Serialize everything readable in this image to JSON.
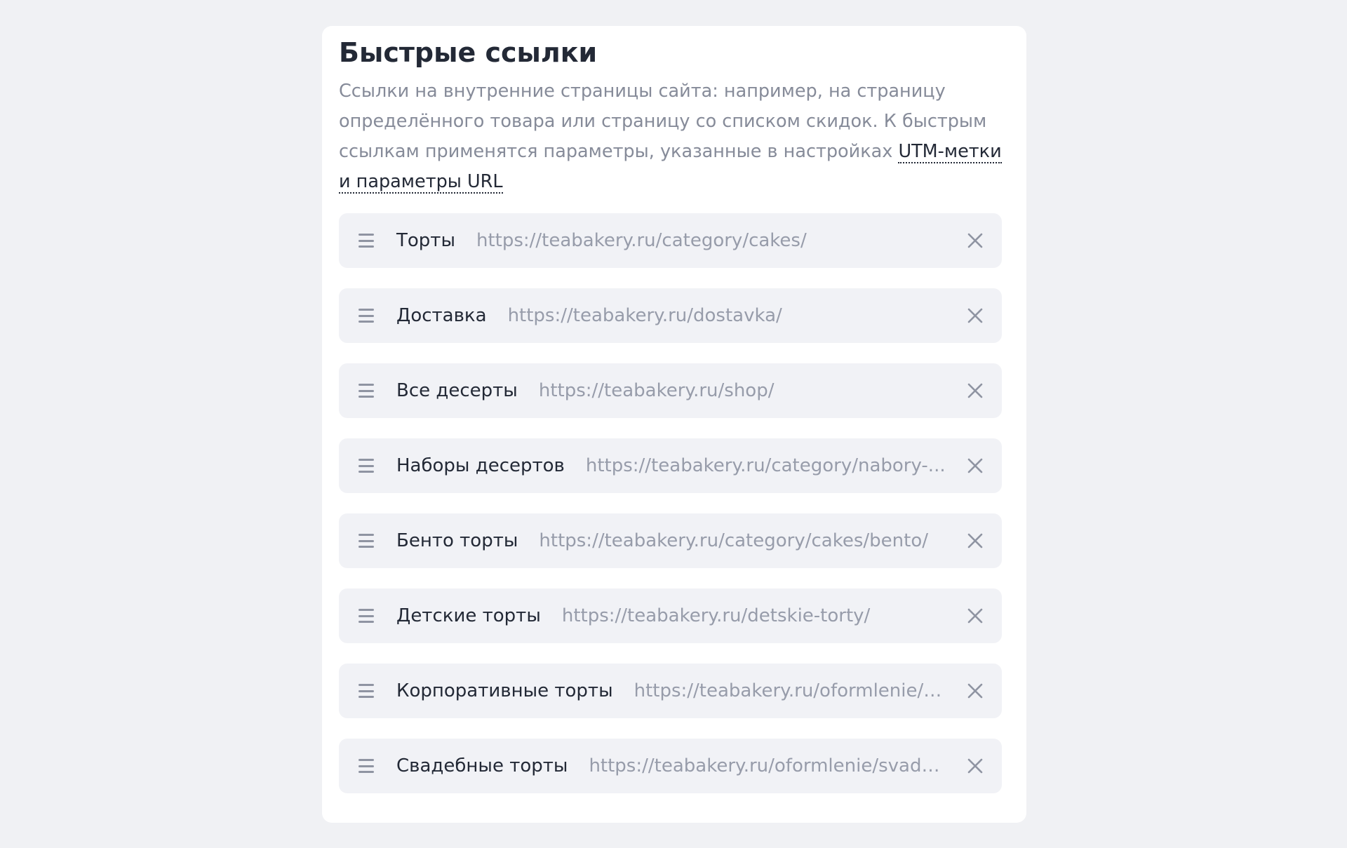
{
  "section": {
    "title": "Быстрые ссылки",
    "description_text": "Ссылки на внутренние страницы сайта: например, на страницу определённого товара или страницу со списком скидок. К быстрым ссылкам применятся параметры, указанные в настройках ",
    "description_link": "UTM-метки и параметры URL"
  },
  "links": [
    {
      "name": "Торты",
      "url": "https://teabakery.ru/category/cakes/"
    },
    {
      "name": "Доставка",
      "url": "https://teabakery.ru/dostavka/"
    },
    {
      "name": "Все десерты",
      "url": "https://teabakery.ru/shop/"
    },
    {
      "name": "Наборы десертов",
      "url": "https://teabakery.ru/category/nabory-..."
    },
    {
      "name": "Бенто торты",
      "url": "https://teabakery.ru/category/cakes/bento/"
    },
    {
      "name": "Детские торты",
      "url": "https://teabakery.ru/detskie-torty/"
    },
    {
      "name": "Корпоративные торты",
      "url": "https://teabakery.ru/oformlenie/k..."
    },
    {
      "name": "Свадебные торты",
      "url": "https://teabakery.ru/oformlenie/svade..."
    }
  ],
  "icons": {
    "drag": "drag-handle-icon",
    "remove": "close-icon"
  },
  "colors": {
    "page_background": "#f0f1f4",
    "card_background": "#ffffff",
    "row_background": "#f1f2f6",
    "title_text": "#232936",
    "muted_text": "#868b99",
    "url_text": "#979caa",
    "icon": "#8f94a2"
  }
}
